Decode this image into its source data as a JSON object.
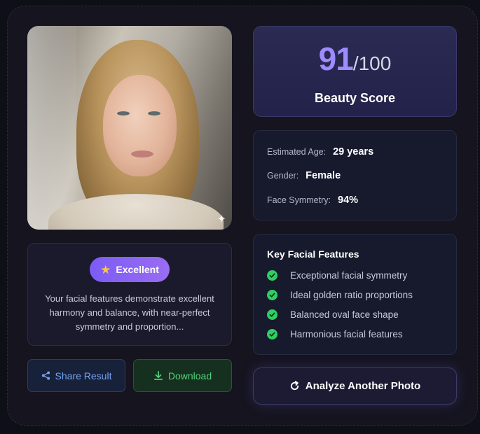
{
  "score": {
    "value": "91",
    "denominator": "/100",
    "label": "Beauty Score"
  },
  "rating": {
    "badge": "Excellent",
    "description": "Your facial features demonstrate excellent harmony and balance, with near-perfect symmetry and proportion..."
  },
  "stats": [
    {
      "label": "Estimated Age:",
      "value": "29 years"
    },
    {
      "label": "Gender:",
      "value": "Female"
    },
    {
      "label": "Face Symmetry:",
      "value": "94%"
    }
  ],
  "features": {
    "title": "Key Facial Features",
    "items": [
      "Exceptional facial symmetry",
      "Ideal golden ratio proportions",
      "Balanced oval face shape",
      "Harmonious facial features"
    ]
  },
  "actions": {
    "share": "Share Result",
    "download": "Download",
    "analyze": "Analyze Another Photo"
  },
  "icons": {
    "badge": "star-icon",
    "share": "share-icon",
    "download": "download-icon",
    "analyze": "refresh-icon",
    "feature": "check-circle-icon",
    "photo_corner": "sparkle-icon"
  },
  "colors": {
    "accent": "#9d8bff",
    "share": "#74a2ef",
    "download": "#4ed37b",
    "check": "#2fcf62"
  }
}
